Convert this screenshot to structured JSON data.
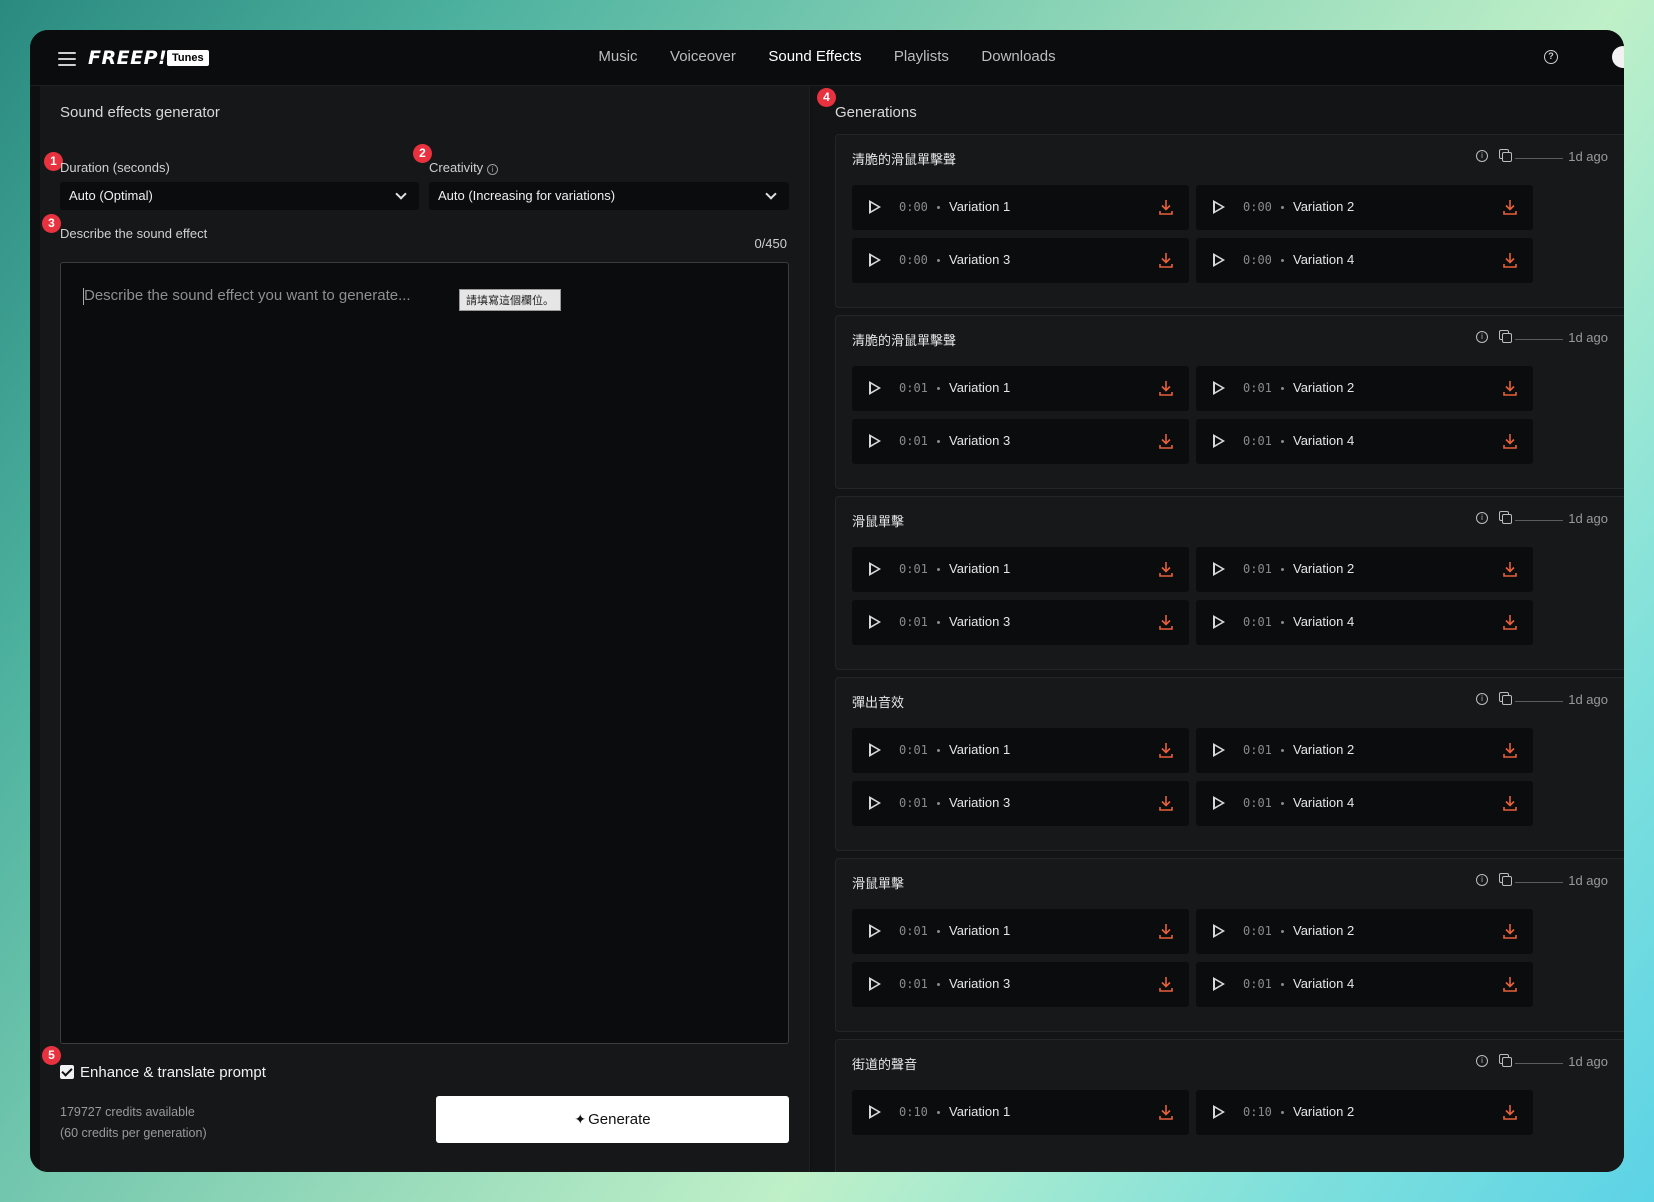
{
  "topbar": {
    "logo": "FREEP!K",
    "logo_badge": "Tunes",
    "nav": [
      "Music",
      "Voiceover",
      "Sound Effects",
      "Playlists",
      "Downloads"
    ],
    "active_nav": "Sound Effects"
  },
  "left": {
    "title": "Sound effects generator",
    "duration_label": "Duration (seconds)",
    "duration_value": "Auto (Optimal)",
    "creativity_label": "Creativity",
    "creativity_value": "Auto (Increasing for variations)",
    "describe_label": "Describe the sound effect",
    "counter": "0/450",
    "placeholder": "Describe the sound effect you want to generate...",
    "tooltip": "請填寫這個欄位。",
    "enhance_label": "Enhance & translate prompt",
    "enhance_checked": true,
    "credits_line1": "179727 credits available",
    "credits_line2": "(60 credits per generation)",
    "generate_label": "Generate"
  },
  "markers": [
    "1",
    "2",
    "3",
    "4",
    "5"
  ],
  "right": {
    "title": "Generations",
    "generations": [
      {
        "title": "清脆的滑鼠單擊聲",
        "ago": "1d ago",
        "variations": [
          {
            "time": "0:00",
            "name": "Variation 1"
          },
          {
            "time": "0:00",
            "name": "Variation 2"
          },
          {
            "time": "0:00",
            "name": "Variation 3"
          },
          {
            "time": "0:00",
            "name": "Variation 4"
          }
        ]
      },
      {
        "title": "清脆的滑鼠單擊聲",
        "ago": "1d ago",
        "variations": [
          {
            "time": "0:01",
            "name": "Variation 1"
          },
          {
            "time": "0:01",
            "name": "Variation 2"
          },
          {
            "time": "0:01",
            "name": "Variation 3"
          },
          {
            "time": "0:01",
            "name": "Variation 4"
          }
        ]
      },
      {
        "title": "滑鼠單擊",
        "ago": "1d ago",
        "variations": [
          {
            "time": "0:01",
            "name": "Variation 1"
          },
          {
            "time": "0:01",
            "name": "Variation 2"
          },
          {
            "time": "0:01",
            "name": "Variation 3"
          },
          {
            "time": "0:01",
            "name": "Variation 4"
          }
        ]
      },
      {
        "title": "彈出音效",
        "ago": "1d ago",
        "variations": [
          {
            "time": "0:01",
            "name": "Variation 1"
          },
          {
            "time": "0:01",
            "name": "Variation 2"
          },
          {
            "time": "0:01",
            "name": "Variation 3"
          },
          {
            "time": "0:01",
            "name": "Variation 4"
          }
        ]
      },
      {
        "title": "滑鼠單擊",
        "ago": "1d ago",
        "variations": [
          {
            "time": "0:01",
            "name": "Variation 1"
          },
          {
            "time": "0:01",
            "name": "Variation 2"
          },
          {
            "time": "0:01",
            "name": "Variation 3"
          },
          {
            "time": "0:01",
            "name": "Variation 4"
          }
        ]
      },
      {
        "title": "街道的聲音",
        "ago": "1d ago",
        "variations": [
          {
            "time": "0:10",
            "name": "Variation 1"
          },
          {
            "time": "0:10",
            "name": "Variation 2"
          }
        ]
      }
    ]
  },
  "colors": {
    "accent_download": "#e8603c",
    "marker": "#e8323f",
    "background": "#0e0f10"
  }
}
